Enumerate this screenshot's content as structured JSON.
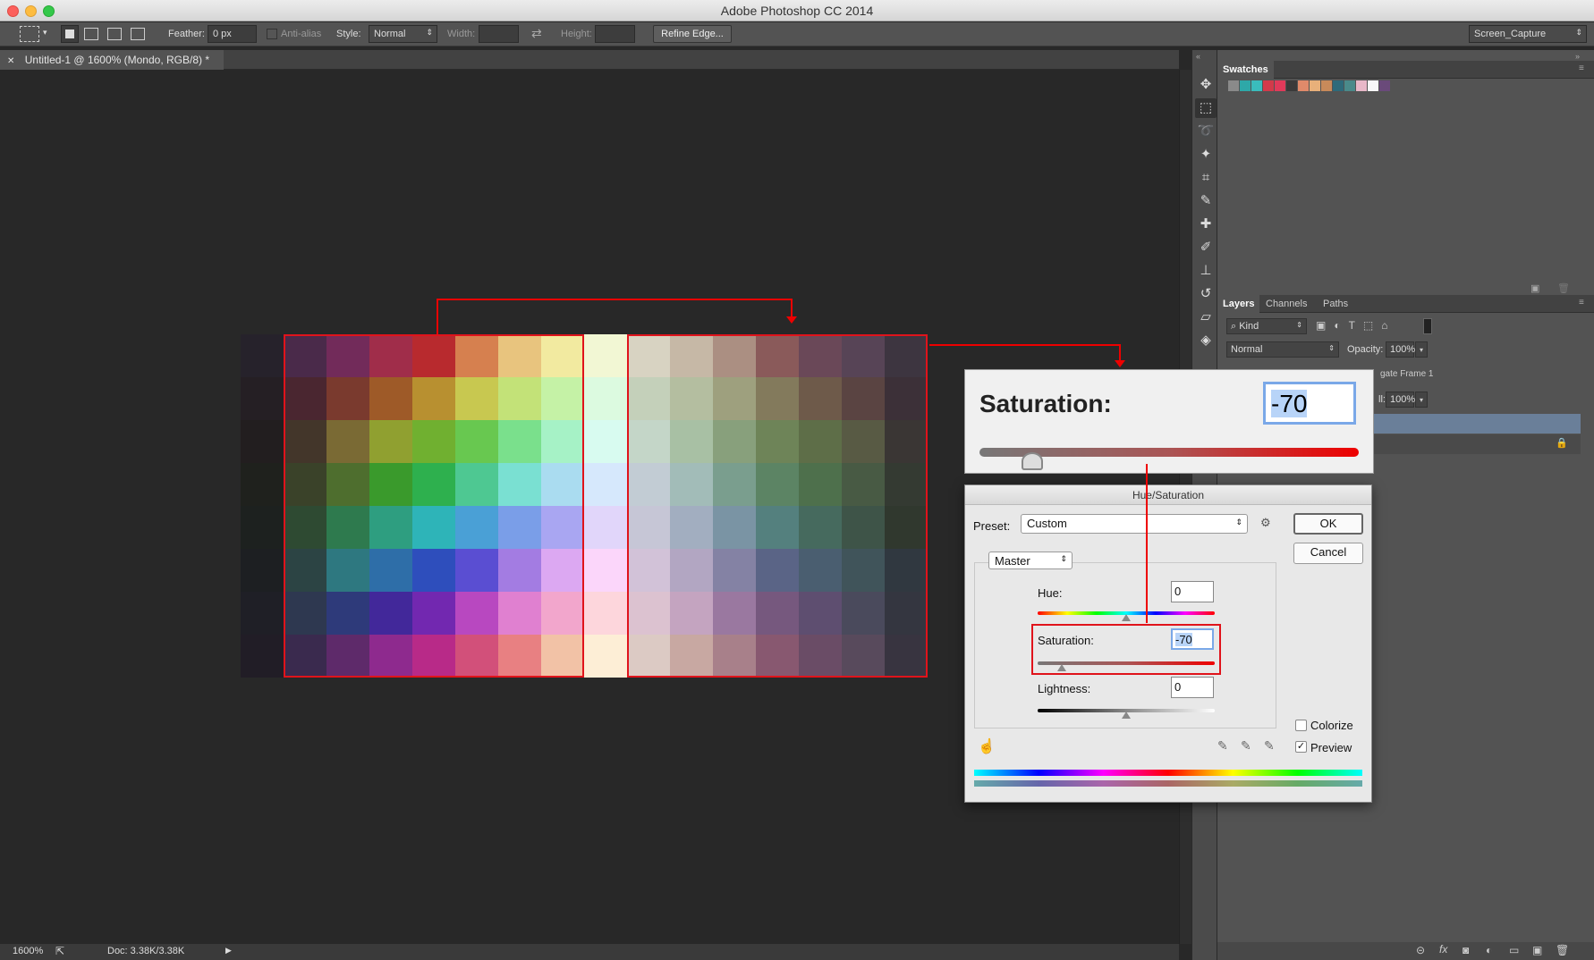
{
  "app": {
    "window_title": "Adobe Photoshop CC 2014"
  },
  "options_bar": {
    "feather_label": "Feather:",
    "feather_value": "0 px",
    "anti_alias_label": "Anti-alias",
    "style_label": "Style:",
    "style_value": "Normal",
    "width_label": "Width:",
    "height_label": "Height:",
    "refine_edge_label": "Refine Edge...",
    "workspace_value": "Screen_Capture"
  },
  "document": {
    "tab_label": "Untitled-1 @ 1600% (Mondo, RGB/8) *",
    "zoom": "1600%",
    "doc_info": "Doc: 3.38K/3.38K"
  },
  "swatch_grid": {
    "rows": [
      [
        "#26222b",
        "#4a2a4a",
        "#722b5a",
        "#a02d4a",
        "#b82a2e",
        "#d6804f",
        "#e8c47e",
        "#f2eaa0",
        "#f2f7d4",
        "#d8d3c2",
        "#c6b8a6",
        "#ab8f82",
        "#8a5a5a",
        "#6a4858",
        "#574456",
        "#3d3540"
      ],
      [
        "#251f24",
        "#4a2630",
        "#7a3a2e",
        "#9e5a28",
        "#b89030",
        "#c8c850",
        "#c3e278",
        "#c5f2a6",
        "#dcfae0",
        "#c4d0ba",
        "#b4bea0",
        "#9ea07e",
        "#837a5c",
        "#6e5a4a",
        "#5a4442",
        "#3c3038"
      ],
      [
        "#221e1f",
        "#43362a",
        "#7a6a34",
        "#90a030",
        "#70b030",
        "#68c850",
        "#7ae08c",
        "#a6f2c6",
        "#d8fbf0",
        "#c4d6c8",
        "#a8c0a4",
        "#88a07c",
        "#6e8458",
        "#5e6e48",
        "#585a44",
        "#3a3634"
      ],
      [
        "#1f211d",
        "#3a4229",
        "#4e6e2e",
        "#3a9a2c",
        "#2eb04e",
        "#4ec892",
        "#7ae0d2",
        "#aadcf0",
        "#d6e8fc",
        "#c2ccd4",
        "#a2bcb8",
        "#7a9e8e",
        "#5c8464",
        "#4e704c",
        "#485a44",
        "#343a32"
      ],
      [
        "#1d211f",
        "#2e4a32",
        "#2e7a4e",
        "#2e9e80",
        "#2eb4b8",
        "#4aa0d6",
        "#7a9ee8",
        "#a9a6f2",
        "#e1d6fa",
        "#c6c6d6",
        "#a2aec0",
        "#7a94a4",
        "#54807e",
        "#466a5e",
        "#3e5448",
        "#30382e"
      ],
      [
        "#1d1f22",
        "#2c4444",
        "#2e7880",
        "#2e6ea8",
        "#2e4ebc",
        "#5a4ed2",
        "#a37ce2",
        "#dca8f2",
        "#fbd6fa",
        "#d2c2d8",
        "#b2a6c2",
        "#8482a4",
        "#5a6486",
        "#4a5e70",
        "#40545a",
        "#303840"
      ],
      [
        "#1f1f26",
        "#2e3850",
        "#2e3a7a",
        "#42289a",
        "#7228b0",
        "#b848c0",
        "#e080d0",
        "#f2a6cc",
        "#fdd6dc",
        "#dcc2d0",
        "#c4a4c0",
        "#9a78a0",
        "#76587e",
        "#5e4e70",
        "#4a4a5c",
        "#343640"
      ],
      [
        "#211d26",
        "#3a2a4e",
        "#5e2a6a",
        "#8e2a8e",
        "#b82a88",
        "#d2507a",
        "#e88082",
        "#f2c2a6",
        "#fdeed6",
        "#dccac4",
        "#c8a8a2",
        "#a8808a",
        "#885870",
        "#6a4c66",
        "#584a5c",
        "#383440"
      ]
    ]
  },
  "saturation_zoom": {
    "label": "Saturation:",
    "value": "-70"
  },
  "hue_saturation_dialog": {
    "title": "Hue/Saturation",
    "preset_label": "Preset:",
    "preset_value": "Custom",
    "ok_label": "OK",
    "cancel_label": "Cancel",
    "channel_value": "Master",
    "hue_label": "Hue:",
    "hue_value": "0",
    "saturation_label": "Saturation:",
    "saturation_value": "-70",
    "lightness_label": "Lightness:",
    "lightness_value": "0",
    "colorize_label": "Colorize",
    "colorize_checked": false,
    "preview_label": "Preview",
    "preview_checked": true
  },
  "swatches_panel": {
    "tab_label": "Swatches",
    "colors": [
      "#8a8a8a",
      "#2ea8a8",
      "#3abcbc",
      "#d23a4a",
      "#e03a5a",
      "#3a3a3a",
      "#e08a6a",
      "#e8b07a",
      "#c88a5a",
      "#2e6a7a",
      "#4a8a8a",
      "#e8b8c8",
      "#f8f8f8",
      "#6a4a7a"
    ]
  },
  "layers_panel": {
    "tabs": [
      "Layers",
      "Channels",
      "Paths"
    ],
    "filter_value": "Kind",
    "blend_mode": "Normal",
    "opacity_label": "Opacity:",
    "opacity_value": "100%",
    "fill_label": "ll:",
    "fill_value": "100%",
    "layer_name_partial": "gate Frame 1"
  }
}
